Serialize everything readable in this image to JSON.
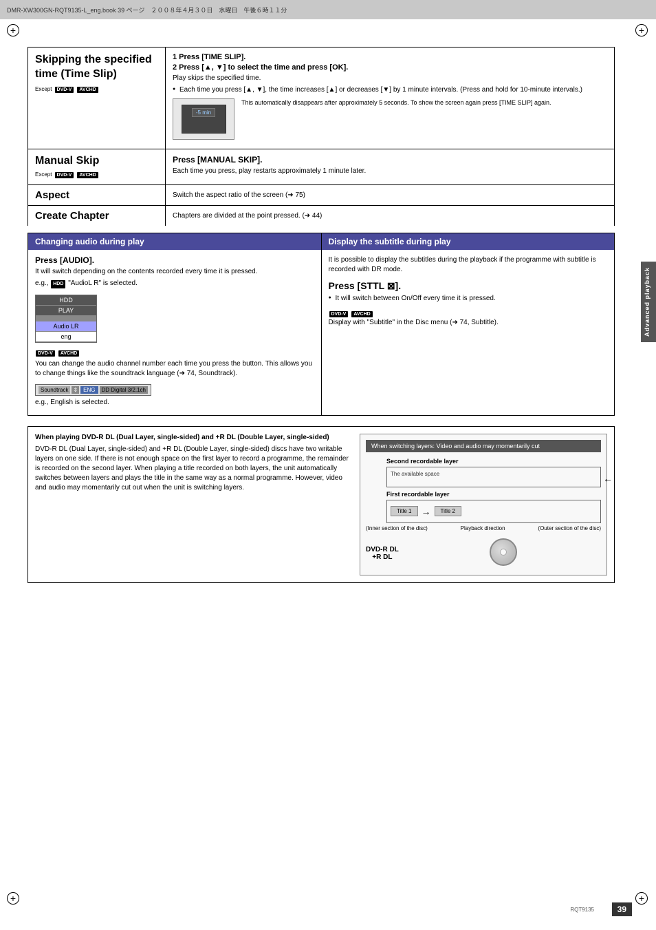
{
  "topBar": {
    "text": "DMR-XW300GN-RQT9135-L_eng.book  39 ページ　２００８年４月３０日　水曜日　午後６時１１分"
  },
  "verticalTab": {
    "label": "Advanced playback"
  },
  "section1": {
    "title": "Skipping the specified time (Time Slip)",
    "except_label": "Except",
    "badge1": "DVD-V",
    "badge2": "AVCHD",
    "step1": "1  Press [TIME SLIP].",
    "step2": "2  Press [▲, ▼] to select the time and press [OK].",
    "body1": "Play skips the specified time.",
    "bullet1": "Each time you press [▲, ▼], the time increases [▲] or decreases [▼] by 1 minute intervals. (Press and hold for 10-minute intervals.)",
    "displayCaption": "This automatically disappears after approximately 5 seconds. To show the screen again press [TIME SLIP] again.",
    "timerText": "-5 min"
  },
  "section2": {
    "title": "Manual Skip",
    "except_label": "Except",
    "badge1": "DVD-V",
    "badge2": "AVCHD",
    "press": "Press [MANUAL SKIP].",
    "body": "Each time you press, play restarts approximately 1 minute later."
  },
  "section3": {
    "title": "Aspect",
    "body": "Switch the aspect ratio of the screen (➜ 75)"
  },
  "section4": {
    "title": "Create Chapter",
    "body": "Chapters are divided at the point pressed. (➜ 44)"
  },
  "audioSection": {
    "header": "Changing audio during play",
    "press": "Press [AUDIO].",
    "body1": "It will switch depending on the contents recorded every time it is pressed.",
    "example": "e.g., HDD \"AudioL R\" is selected.",
    "hdd_badge": "HDD",
    "hdd_rows": [
      "HDD",
      "PLAY",
      "",
      "Audio LR",
      "eng"
    ],
    "dvdv_badge": "DVD-V",
    "avchd_badge": "AVCHD",
    "body2": "You can change the audio channel number each time you press the button. This allows you to change things like the soundtrack language (➜ 74, Soundtrack).",
    "soundtrack_label": "Soundtrack",
    "soundtrack_eng": "ENG",
    "soundtrack_dd": "DD Digital  3/2.1ch",
    "example2": "e.g., English is selected."
  },
  "subtitleSection": {
    "header": "Display the subtitle during play",
    "body1": "It is possible to display the subtitles during the playback if the programme with subtitle is recorded with DR mode.",
    "press": "Press [STTL ⊠].",
    "bullet1": "It will switch between On/Off every time it is pressed.",
    "badge1": "DVD-V",
    "badge2": "AVCHD",
    "body2": "Display with \"Subtitle\" in the Disc menu (➜ 74, Subtitle)."
  },
  "bottomSection": {
    "title": "When playing DVD-R DL (Dual Layer, single-sided) and +R DL (Double Layer, single-sided)",
    "body": "DVD-R DL (Dual Layer, single-sided) and +R DL (Double Layer, single-sided) discs have two writable layers on one side. If there is not enough space on the first layer to record a programme, the remainder is recorded on the second layer. When playing a title recorded on both layers, the unit automatically switches between layers and plays the title in the same way as a normal programme. However, video and audio may momentarily cut out when the unit is switching layers.",
    "diagram": {
      "header": "When switching layers:\nVideo and audio may momentarily cut",
      "layer2_label": "Second recordable layer",
      "layer2_text": "The available space",
      "layer1_label": "First recordable layer",
      "title1": "Title 1",
      "title2": "Title 2",
      "arrow": "→",
      "playback_dir": "Playback direction",
      "inner": "(Inner section of the disc)",
      "outer": "(Outer section of the disc)",
      "dvd_label": "DVD-R DL\n+R DL"
    }
  },
  "footer": {
    "docref": "RQT9135",
    "pageNum": "39"
  }
}
